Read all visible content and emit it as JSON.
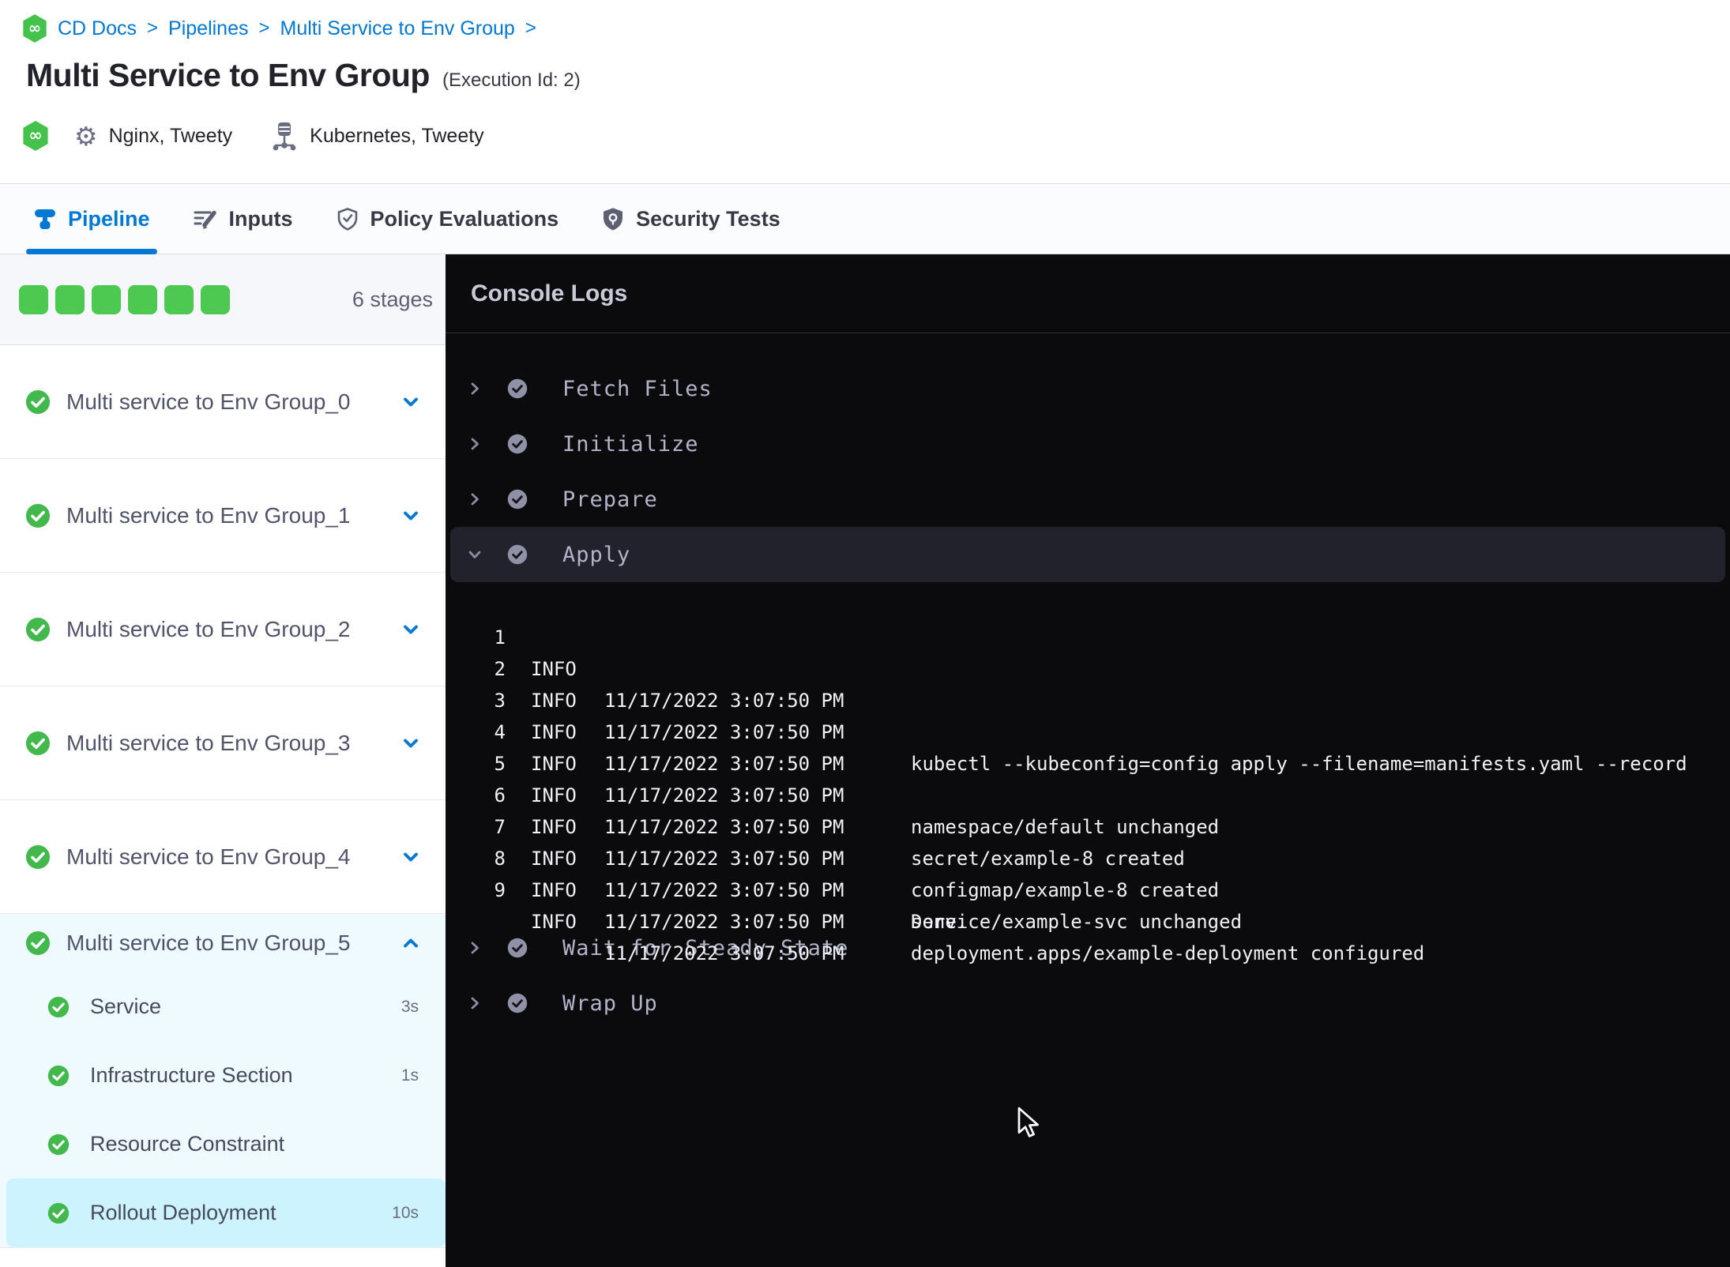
{
  "colors": {
    "accent_blue": "#0278d5",
    "success_green": "#4dc952",
    "console_bg": "#0b0b0e",
    "expanded_stage_bg": "#eefaff",
    "selected_step_bg": "#cdf4fe"
  },
  "breadcrumb": {
    "items": [
      "CD Docs",
      "Pipelines",
      "Multi Service to Env Group"
    ],
    "separator": ">"
  },
  "page": {
    "title": "Multi Service to Env Group",
    "execution_id": "(Execution Id: 2)"
  },
  "meta": {
    "services_label": "Nginx, Tweety",
    "infrastructure_label": "Kubernetes, Tweety"
  },
  "tabs": [
    {
      "id": "pipeline",
      "label": "Pipeline",
      "icon": "pipeline-icon",
      "active": true
    },
    {
      "id": "inputs",
      "label": "Inputs",
      "icon": "inputs-icon",
      "active": false
    },
    {
      "id": "policy-evaluations",
      "label": "Policy Evaluations",
      "icon": "shield-check-icon",
      "active": false
    },
    {
      "id": "security-tests",
      "label": "Security Tests",
      "icon": "shield-scan-icon",
      "active": false
    }
  ],
  "sidebar": {
    "stage_count": 6,
    "stage_count_label": "6 stages",
    "stages": [
      {
        "label": "Multi service to Env Group_0",
        "status": "success",
        "expanded": false
      },
      {
        "label": "Multi service to Env Group_1",
        "status": "success",
        "expanded": false
      },
      {
        "label": "Multi service to Env Group_2",
        "status": "success",
        "expanded": false
      },
      {
        "label": "Multi service to Env Group_3",
        "status": "success",
        "expanded": false
      },
      {
        "label": "Multi service to Env Group_4",
        "status": "success",
        "expanded": false
      },
      {
        "label": "Multi service to Env Group_5",
        "status": "success",
        "expanded": true,
        "steps": [
          {
            "label": "Service",
            "duration": "3s",
            "selected": false
          },
          {
            "label": "Infrastructure Section",
            "duration": "1s",
            "selected": false
          },
          {
            "label": "Resource Constraint",
            "duration": "",
            "selected": false
          },
          {
            "label": "Rollout Deployment",
            "duration": "10s",
            "selected": true
          }
        ]
      }
    ]
  },
  "console": {
    "title": "Console Logs",
    "sections": [
      {
        "label": "Fetch Files",
        "status": "success",
        "expanded": false
      },
      {
        "label": "Initialize",
        "status": "success",
        "expanded": false
      },
      {
        "label": "Prepare",
        "status": "success",
        "expanded": false
      },
      {
        "label": "Apply",
        "status": "success",
        "expanded": true,
        "logs": [
          {
            "num": "1",
            "level": "INFO",
            "time": "11/17/2022 3:07:50 PM",
            "message": ""
          },
          {
            "num": "2",
            "level": "INFO",
            "time": "11/17/2022 3:07:50 PM",
            "message": "kubectl --kubeconfig=config apply --filename=manifests.yaml --record"
          },
          {
            "num": "3",
            "level": "INFO",
            "time": "11/17/2022 3:07:50 PM",
            "message": ""
          },
          {
            "num": "4",
            "level": "INFO",
            "time": "11/17/2022 3:07:50 PM",
            "message": "namespace/default unchanged"
          },
          {
            "num": "5",
            "level": "INFO",
            "time": "11/17/2022 3:07:50 PM",
            "message": "secret/example-8 created"
          },
          {
            "num": "6",
            "level": "INFO",
            "time": "11/17/2022 3:07:50 PM",
            "message": "configmap/example-8 created"
          },
          {
            "num": "7",
            "level": "INFO",
            "time": "11/17/2022 3:07:50 PM",
            "message": "service/example-svc unchanged"
          },
          {
            "num": "8",
            "level": "INFO",
            "time": "11/17/2022 3:07:50 PM",
            "message": "deployment.apps/example-deployment configured"
          },
          {
            "num": "9",
            "level": "INFO",
            "time": "11/17/2022 3:07:50 PM",
            "message": ""
          }
        ],
        "tail_message": "Done."
      },
      {
        "label": "Wait for Steady State",
        "status": "success",
        "expanded": false
      },
      {
        "label": "Wrap Up",
        "status": "success",
        "expanded": false
      }
    ]
  }
}
